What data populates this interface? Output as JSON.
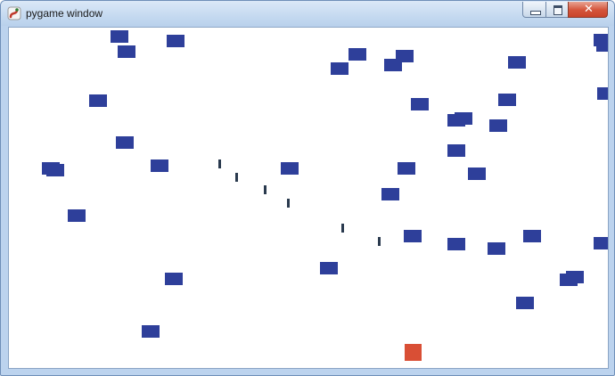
{
  "window": {
    "title": "pygame window",
    "icon": "pygame-snake-icon",
    "minimize_icon": "minimize-icon",
    "maximize_icon": "maximize-icon",
    "close_icon": "close-icon",
    "close_glyph": "✕"
  },
  "colors": {
    "enemy": "#2e3f9a",
    "bullet": "#2a3a4e",
    "player": "#d94f35",
    "background": "#ffffff"
  },
  "game": {
    "enemy_count": 47,
    "bullet_count": 7,
    "player_count": 1
  }
}
